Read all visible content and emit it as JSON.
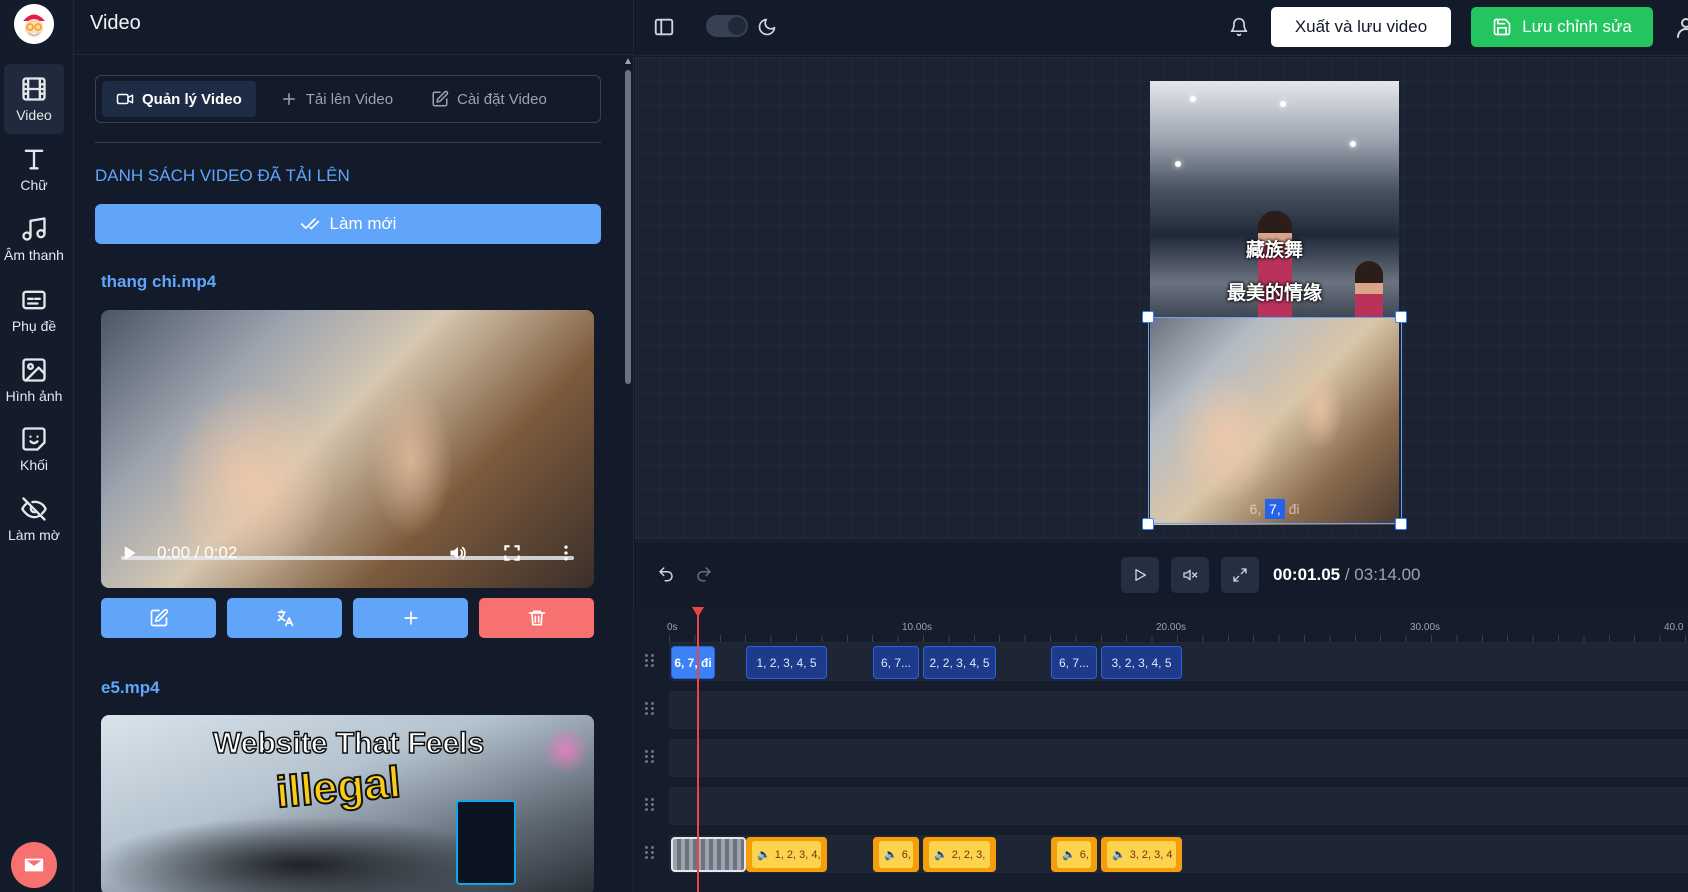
{
  "header": {
    "panel_title": "Video"
  },
  "rail": {
    "items": [
      {
        "label": "Video",
        "icon": "film-icon"
      },
      {
        "label": "Chữ",
        "icon": "text-icon"
      },
      {
        "label": "Âm thanh",
        "icon": "music-icon"
      },
      {
        "label": "Phụ đề",
        "icon": "subtitle-icon"
      },
      {
        "label": "Hình ảnh",
        "icon": "image-icon"
      },
      {
        "label": "Khối",
        "icon": "sticker-icon"
      },
      {
        "label": "Làm mờ",
        "icon": "eye-off-icon"
      }
    ]
  },
  "tabs": [
    {
      "label": "Quản lý Video",
      "icon": "video-camera-icon",
      "active": true
    },
    {
      "label": "Tải lên Video",
      "icon": "plus-icon",
      "active": false
    },
    {
      "label": "Cài đặt Video",
      "icon": "edit-icon",
      "active": false
    }
  ],
  "library": {
    "section_title": "DANH SÁCH VIDEO ĐÃ TẢI LÊN",
    "refresh_label": "Làm mới",
    "videos": [
      {
        "name": "thang chi.mp4",
        "time": "0:00 / 0:02"
      },
      {
        "name": "e5.mp4",
        "thumb_line1": "Website That Feels",
        "thumb_line2": "illegal"
      }
    ]
  },
  "toolbar": {
    "export_label": "Xuất và lưu video",
    "save_label": "Lưu chỉnh sửa"
  },
  "preview": {
    "subtitle_line1": "藏族舞",
    "subtitle_line2": "最美的情缘",
    "word_before": "6,",
    "word_highlight": "7,",
    "word_after": "đi"
  },
  "playback": {
    "current_time": "00:01.05",
    "total_time": "/ 03:14.00"
  },
  "timeline": {
    "ruler_labels": [
      "0s",
      "10.00s",
      "20.00s",
      "30.00s",
      "40.0"
    ],
    "subtitle_clips": [
      "6, 7, đi",
      "1, 2, 3, 4, 5",
      "6, 7...",
      "2, 2, 3, 4, 5",
      "6, 7...",
      "3, 2, 3, 4, 5"
    ],
    "audio_clips": [
      "1, 2, 3, 4,",
      "6,",
      "2, 2, 3,",
      "6,",
      "3, 2, 3, 4"
    ]
  },
  "colors": {
    "accent_blue": "#60a5fa",
    "save_green": "#22c55e",
    "delete_red": "#f87171",
    "playhead_red": "#ef4444",
    "audio_orange": "#f59e0b"
  }
}
